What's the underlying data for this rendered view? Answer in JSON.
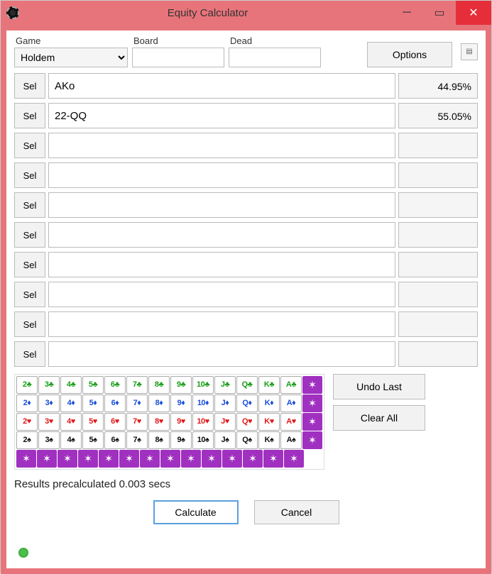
{
  "window": {
    "title": "Equity Calculator"
  },
  "form": {
    "game_label": "Game",
    "game_value": "Holdem",
    "board_label": "Board",
    "board_value": "",
    "dead_label": "Dead",
    "dead_value": "",
    "options_label": "Options"
  },
  "sel_label": "Sel",
  "rows": [
    {
      "range": "AKo",
      "equity": "44.95%"
    },
    {
      "range": "22-QQ",
      "equity": "55.05%"
    },
    {
      "range": "",
      "equity": ""
    },
    {
      "range": "",
      "equity": ""
    },
    {
      "range": "",
      "equity": ""
    },
    {
      "range": "",
      "equity": ""
    },
    {
      "range": "",
      "equity": ""
    },
    {
      "range": "",
      "equity": ""
    },
    {
      "range": "",
      "equity": ""
    },
    {
      "range": "",
      "equity": ""
    }
  ],
  "cards": {
    "ranks": [
      "2",
      "3",
      "4",
      "5",
      "6",
      "7",
      "8",
      "9",
      "10",
      "J",
      "Q",
      "K",
      "A"
    ],
    "suits": [
      {
        "key": "c",
        "symbol": "♣"
      },
      {
        "key": "d",
        "symbol": "♦"
      },
      {
        "key": "h",
        "symbol": "♥"
      },
      {
        "key": "s",
        "symbol": "♠"
      }
    ],
    "star_symbol": "✶"
  },
  "buttons": {
    "undo_last": "Undo Last",
    "clear_all": "Clear All",
    "calculate": "Calculate",
    "cancel": "Cancel"
  },
  "status": "Results precalculated 0.003 secs"
}
